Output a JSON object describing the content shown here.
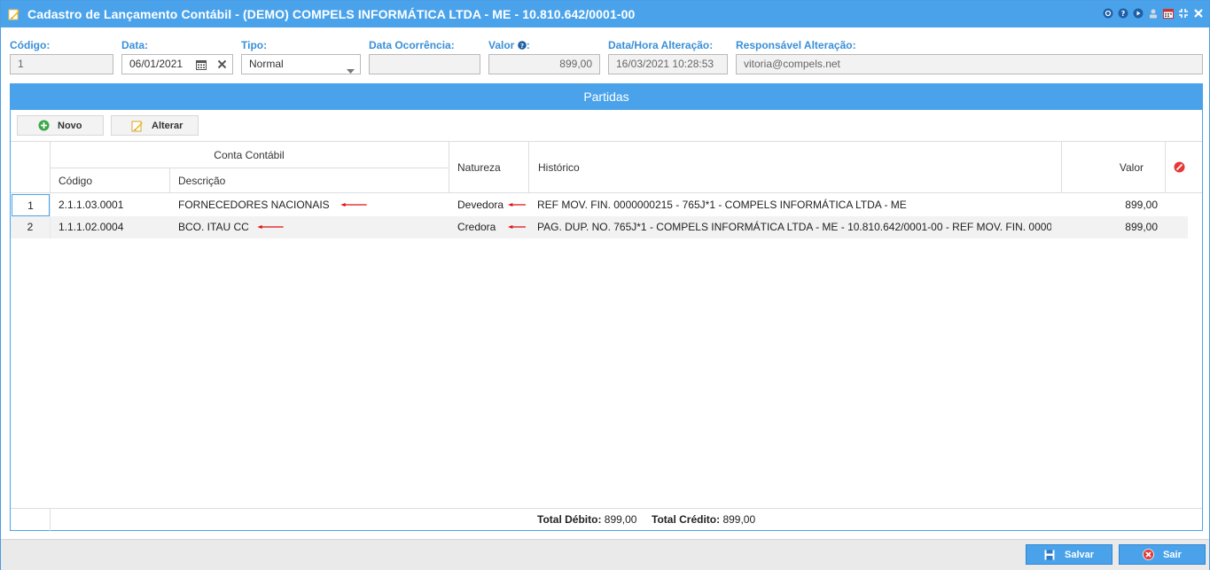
{
  "window": {
    "title": "Cadastro de Lançamento Contábil - (DEMO) COMPELS INFORMÁTICA LTDA - ME - 10.810.642/0001-00",
    "icons": [
      "refresh-icon",
      "help-icon",
      "play-icon",
      "user-icon",
      "calendar-icon",
      "collapse-icon",
      "close-icon"
    ]
  },
  "form": {
    "codigo": {
      "label": "Código:",
      "value": "1"
    },
    "data": {
      "label": "Data:",
      "value": "06/01/2021"
    },
    "tipo": {
      "label": "Tipo:",
      "value": "Normal"
    },
    "data_ocorrencia": {
      "label": "Data Ocorrência:",
      "value": ""
    },
    "valor": {
      "label": "Valor",
      "value": "899,00"
    },
    "data_hora_alteracao": {
      "label": "Data/Hora Alteração:",
      "value": "16/03/2021 10:28:53"
    },
    "responsavel_alteracao": {
      "label": "Responsável Alteração:",
      "value": "vitoria@compels.net"
    }
  },
  "partidas": {
    "title": "Partidas",
    "toolbar": {
      "novo": "Novo",
      "alterar": "Alterar"
    },
    "headers": {
      "conta_contabil": "Conta Contábil",
      "codigo": "Código",
      "descricao": "Descrição",
      "natureza": "Natureza",
      "historico": "Histórico",
      "valor": "Valor"
    },
    "rows": [
      {
        "n": "1",
        "codigo": "2.1.1.03.0001",
        "descricao": "FORNECEDORES NACIONAIS",
        "natureza": "Devedora",
        "historico": "REF MOV. FIN. 0000000215 - 765J*1 - COMPELS INFORMÁTICA LTDA - ME",
        "valor": "899,00"
      },
      {
        "n": "2",
        "codigo": "1.1.1.02.0004",
        "descricao": "BCO. ITAU CC",
        "natureza": "Credora",
        "historico": "PAG. DUP. NO. 765J*1 - COMPELS INFORMÁTICA LTDA - ME - 10.810.642/0001-00 - REF MOV. FIN. 0000...",
        "valor": "899,00"
      }
    ],
    "footer": {
      "total_debito_label": "Total Débito:",
      "total_debito": "899,00",
      "total_credito_label": "Total Crédito:",
      "total_credito": "899,00"
    }
  },
  "buttons": {
    "salvar": "Salvar",
    "sair": "Sair"
  },
  "colors": {
    "accent": "#4aa3ea",
    "label": "#3a8fd8",
    "arrow": "#e01010",
    "clear": "#e53935",
    "add": "#3aa845"
  }
}
